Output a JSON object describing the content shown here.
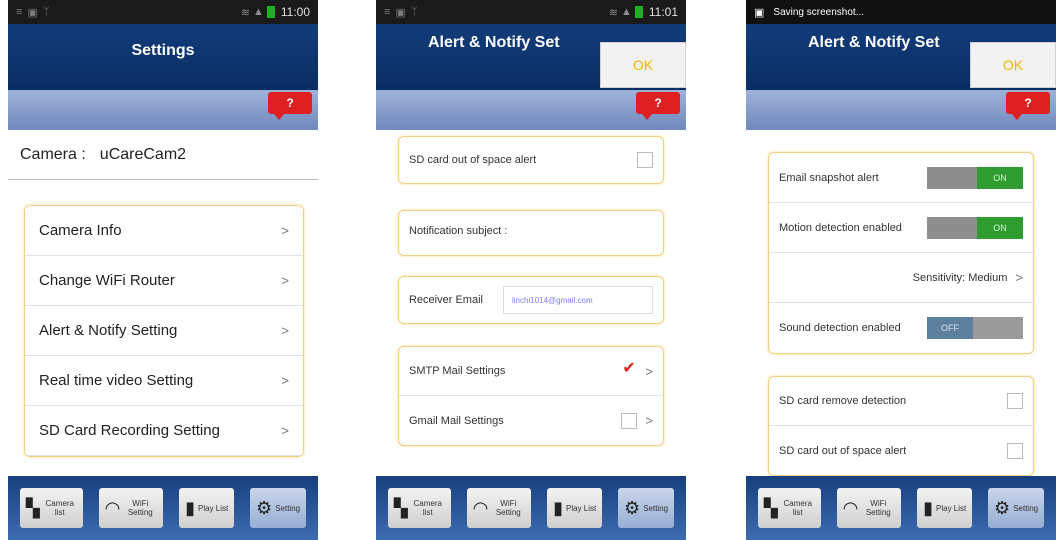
{
  "screens": [
    {
      "status": {
        "time": "11:00"
      },
      "title": "Settings",
      "camera_label": "Camera :",
      "camera_value": "uCareCam2",
      "menu": [
        {
          "label": "Camera Info"
        },
        {
          "label": "Change WiFi Router"
        },
        {
          "label": "Alert & Notify Setting"
        },
        {
          "label": "Real time video Setting"
        },
        {
          "label": "SD Card Recording Setting"
        }
      ]
    },
    {
      "status": {
        "time": "11:01"
      },
      "title": "Alert & Notify Set",
      "ok_label": "OK",
      "rows": {
        "sd_space": "SD card out of space alert",
        "notif_subject": "Notification subject :",
        "receiver_email_label": "Receiver Email",
        "receiver_email_value": "linchi1014@gmail.com",
        "smtp": "SMTP Mail Settings",
        "gmail": "Gmail Mail Settings"
      }
    },
    {
      "status": {
        "message": "Saving screenshot..."
      },
      "title": "Alert & Notify Set",
      "ok_label": "OK",
      "rows": {
        "email_snapshot": "Email snapshot alert",
        "motion": "Motion detection enabled",
        "sensitivity": "Sensitivity: Medium",
        "sound": "Sound detection enabled",
        "sd_remove": "SD card remove detection",
        "sd_space": "SD card out of space alert"
      },
      "toggles": {
        "on": "ON",
        "off": "OFF"
      }
    }
  ],
  "help_label": "?",
  "chevron": ">",
  "tabs": [
    {
      "label": "Camera list",
      "icon": "camera-list-icon"
    },
    {
      "label": "WiFi Setting",
      "icon": "wifi-icon"
    },
    {
      "label": "Play List",
      "icon": "play-list-icon"
    },
    {
      "label": "Setting",
      "icon": "gear-icon"
    }
  ],
  "colors": {
    "header": "#0a2d63",
    "accent_red": "#e02020",
    "toggle_on": "#2e9c2e",
    "ok_text": "#f0b400"
  }
}
